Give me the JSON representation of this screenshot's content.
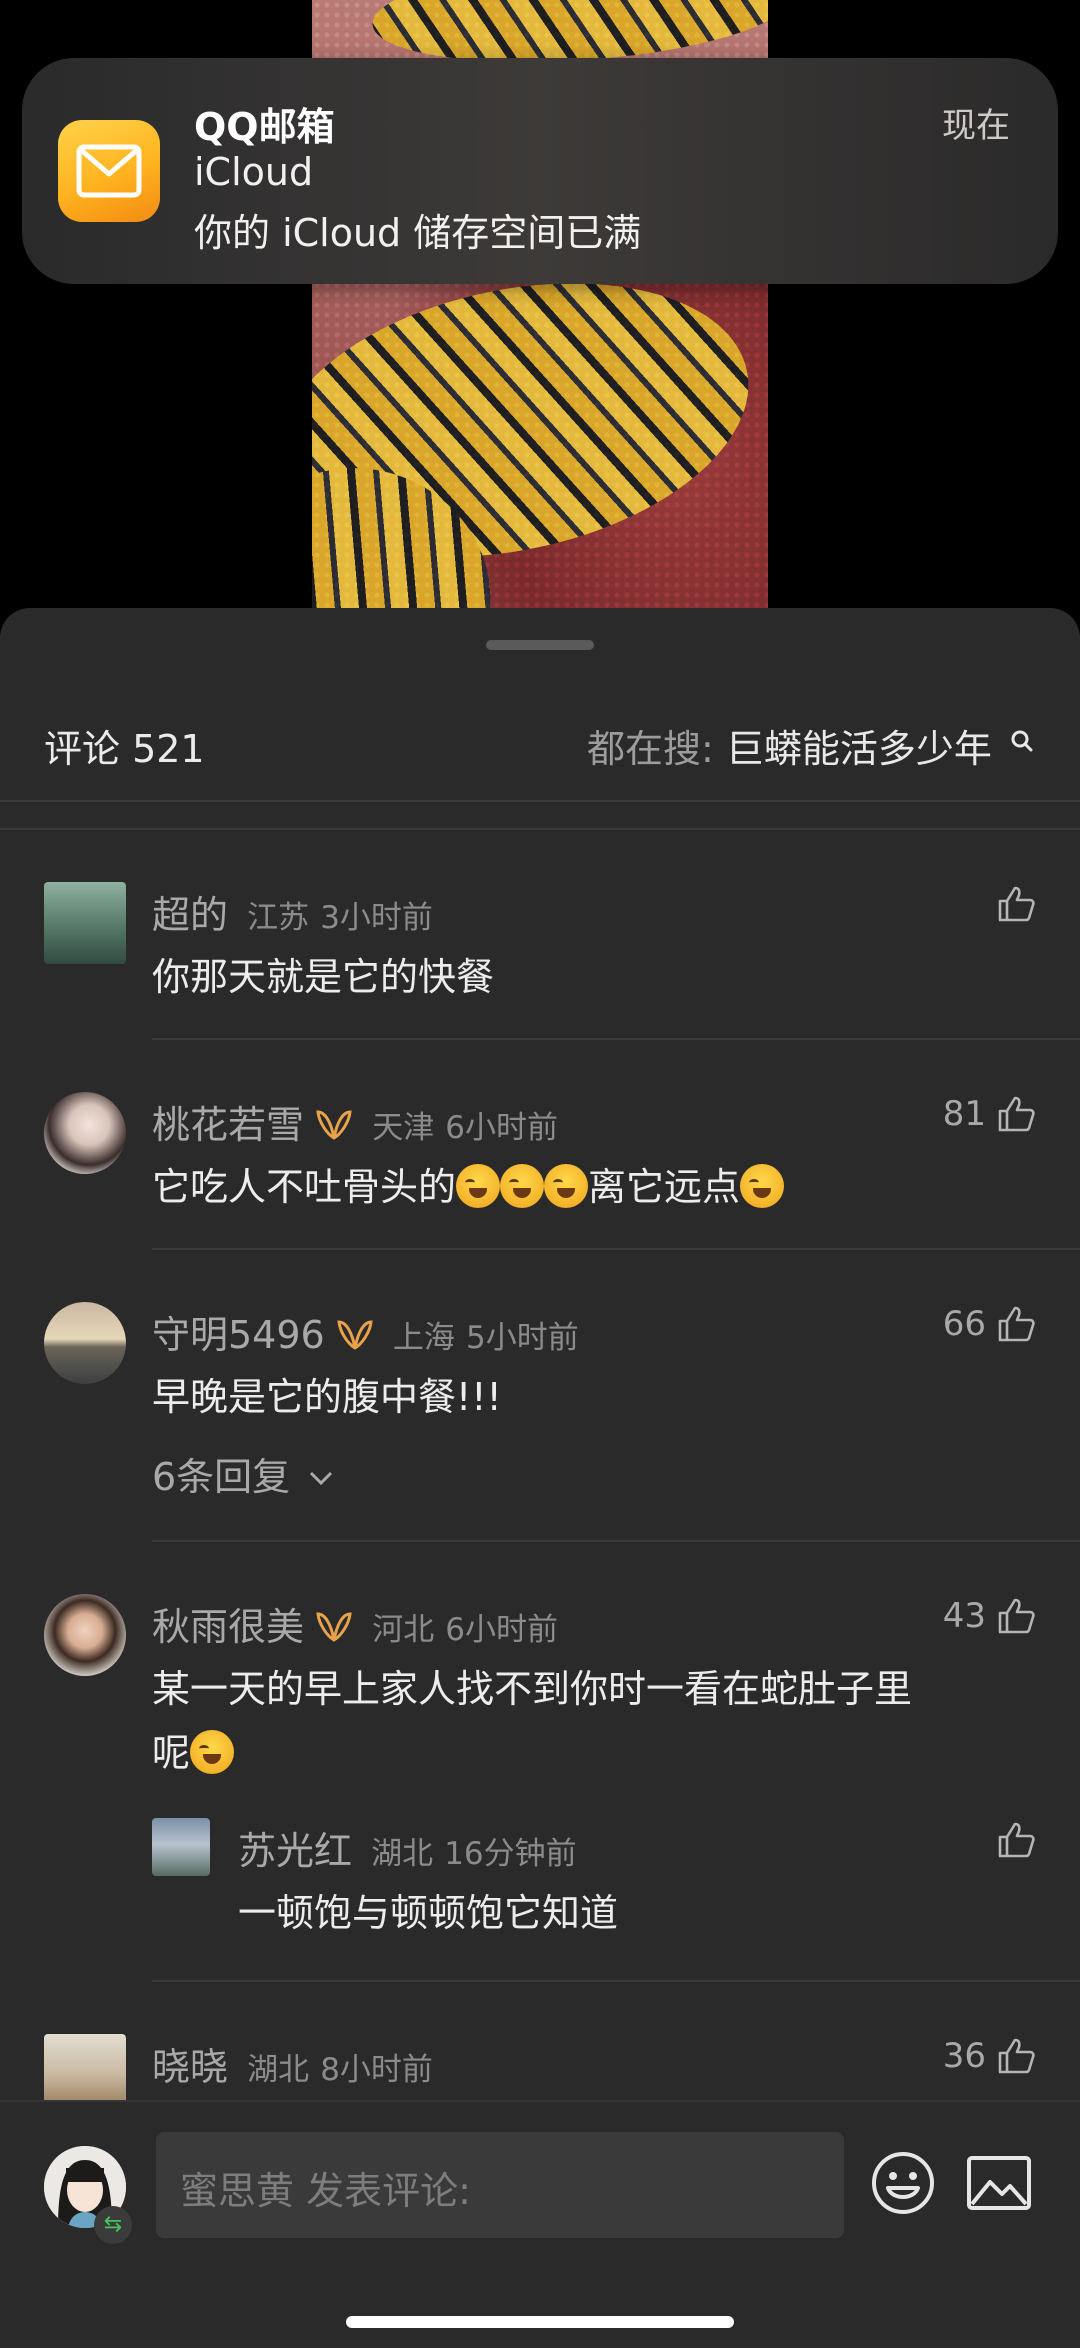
{
  "notification": {
    "app": "QQ邮箱",
    "time": "现在",
    "title": "iCloud",
    "body": "你的 iCloud 储存空间已满"
  },
  "sheet": {
    "comment_count": "评论 521",
    "trending_prefix": "都在搜:",
    "trending_keyword": "巨蟒能活多少年"
  },
  "comments": [
    {
      "name": "超的",
      "location": "江苏",
      "time": "3小时前",
      "text": "你那天就是它的快餐",
      "likes": "",
      "verified": false
    },
    {
      "name": "桃花若雪",
      "location": "天津",
      "time": "6小时前",
      "text_a": "它吃人不吐骨头的",
      "text_b": "离它远点",
      "likes": "81",
      "verified": true
    },
    {
      "name": "守明5496",
      "location": "上海",
      "time": "5小时前",
      "text": "早晚是它的腹中餐!!!",
      "likes": "66",
      "verified": true,
      "replies": "6条回复"
    },
    {
      "name": "秋雨很美",
      "location": "河北",
      "time": "6小时前",
      "text_line1": "某一天的早上家人找不到你时一看在蛇肚子里",
      "text_line2": "呢",
      "likes": "43",
      "verified": true
    },
    {
      "name": "苏光红",
      "location": "湖北",
      "time": "16分钟前",
      "text": "一顿饱与顿顿饱它知道",
      "likes": "",
      "verified": false
    },
    {
      "name": "晓晓",
      "location": "湖北",
      "time": "8小时前",
      "text": "",
      "likes": "36",
      "verified": false
    }
  ],
  "input": {
    "placeholder": "蜜思黄 发表评论:"
  },
  "icons": [
    "mail-icon",
    "search-icon",
    "thumbs-up-icon",
    "verified-badge-icon",
    "chevron-down-icon",
    "emoji-icon",
    "image-icon",
    "swap-icon"
  ],
  "colors": {
    "sheet_bg": "#2a2a2b",
    "badge": "#e8a24a",
    "text_primary": "#ececec",
    "text_secondary": "#a9a9aa"
  }
}
